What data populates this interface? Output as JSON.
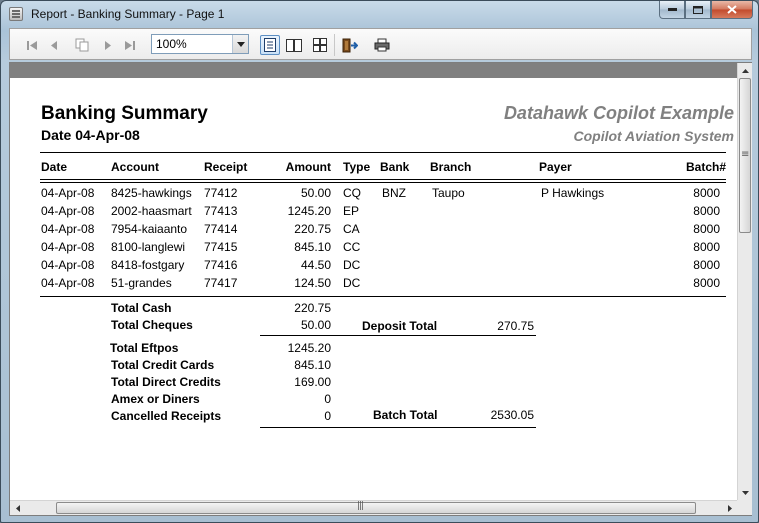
{
  "window": {
    "title": "Report - Banking Summary - Page 1"
  },
  "toolbar": {
    "zoom_value": "100%"
  },
  "report": {
    "title": "Banking Summary",
    "date_label": "Date 04-Apr-08",
    "brand": "Datahawk Copilot Example",
    "subtitle": "Copilot Aviation System",
    "columns": [
      "Date",
      "Account",
      "Receipt",
      "Amount",
      "Type",
      "Bank",
      "Branch",
      "Payer",
      "Batch#"
    ],
    "rows": [
      {
        "date": "04-Apr-08",
        "account": "8425-hawkings",
        "receipt": "77412",
        "amount": "50.00",
        "type": "CQ",
        "bank": "BNZ",
        "branch": "Taupo",
        "payer": "P Hawkings",
        "batch": "8000"
      },
      {
        "date": "04-Apr-08",
        "account": "2002-haasmart",
        "receipt": "77413",
        "amount": "1245.20",
        "type": "EP",
        "bank": "",
        "branch": "",
        "payer": "",
        "batch": "8000"
      },
      {
        "date": "04-Apr-08",
        "account": "7954-kaiaanto",
        "receipt": "77414",
        "amount": "220.75",
        "type": "CA",
        "bank": "",
        "branch": "",
        "payer": "",
        "batch": "8000"
      },
      {
        "date": "04-Apr-08",
        "account": "8100-langlewi",
        "receipt": "77415",
        "amount": "845.10",
        "type": "CC",
        "bank": "",
        "branch": "",
        "payer": "",
        "batch": "8000"
      },
      {
        "date": "04-Apr-08",
        "account": "8418-fostgary",
        "receipt": "77416",
        "amount": "44.50",
        "type": "DC",
        "bank": "",
        "branch": "",
        "payer": "",
        "batch": "8000"
      },
      {
        "date": "04-Apr-08",
        "account": "51-grandes",
        "receipt": "77417",
        "amount": "124.50",
        "type": "DC",
        "bank": "",
        "branch": "",
        "payer": "",
        "batch": "8000"
      }
    ],
    "totals": {
      "cash_label": "Total Cash",
      "cash_value": "220.75",
      "cheques_label": "Total Cheques",
      "cheques_value": "50.00",
      "deposit_label": "Deposit Total",
      "deposit_value": "270.75",
      "eftpos_label": "Total Eftpos",
      "eftpos_value": "1245.20",
      "credit_label": "Total Credit Cards",
      "credit_value": "845.10",
      "direct_label": "Total Direct Credits",
      "direct_value": "169.00",
      "amex_label": "Amex or Diners",
      "amex_value": "0",
      "cancelled_label": "Cancelled Receipts",
      "cancelled_value": "0",
      "batch_label": "Batch Total",
      "batch_value": "2530.05"
    }
  }
}
